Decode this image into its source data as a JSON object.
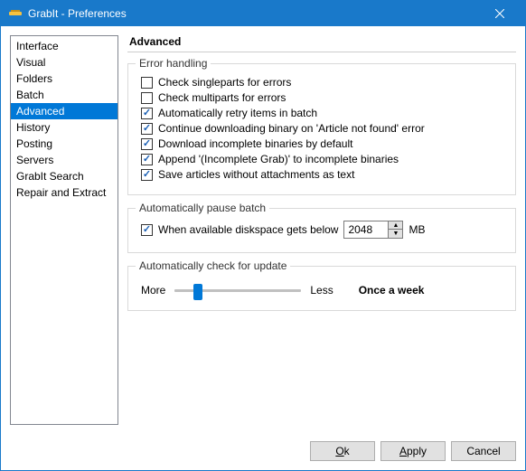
{
  "window": {
    "title": "GrabIt - Preferences"
  },
  "sidebar": {
    "items": [
      {
        "label": "Interface"
      },
      {
        "label": "Visual"
      },
      {
        "label": "Folders"
      },
      {
        "label": "Batch"
      },
      {
        "label": "Advanced",
        "selected": true
      },
      {
        "label": "History"
      },
      {
        "label": "Posting"
      },
      {
        "label": "Servers"
      },
      {
        "label": "GrabIt Search"
      },
      {
        "label": "Repair and Extract"
      }
    ]
  },
  "main": {
    "heading": "Advanced",
    "error_handling": {
      "legend": "Error handling",
      "checks": [
        {
          "label": "Check singleparts for errors",
          "checked": false
        },
        {
          "label": "Check multiparts for errors",
          "checked": false
        },
        {
          "label": "Automatically retry items in batch",
          "checked": true
        },
        {
          "label": "Continue downloading binary on 'Article not found' error",
          "checked": true
        },
        {
          "label": "Download incomplete binaries by default",
          "checked": true
        },
        {
          "label": "Append '(Incomplete Grab)' to incomplete binaries",
          "checked": true
        },
        {
          "label": "Save articles without attachments as text",
          "checked": true
        }
      ]
    },
    "pause_batch": {
      "legend": "Automatically pause batch",
      "check_label": "When available diskspace gets below",
      "checked": true,
      "value": "2048",
      "unit": "MB"
    },
    "update_check": {
      "legend": "Automatically check for update",
      "more": "More",
      "less": "Less",
      "current": "Once a week",
      "position_pct": 15
    }
  },
  "footer": {
    "ok": "Ok",
    "apply": "Apply",
    "cancel": "Cancel"
  }
}
